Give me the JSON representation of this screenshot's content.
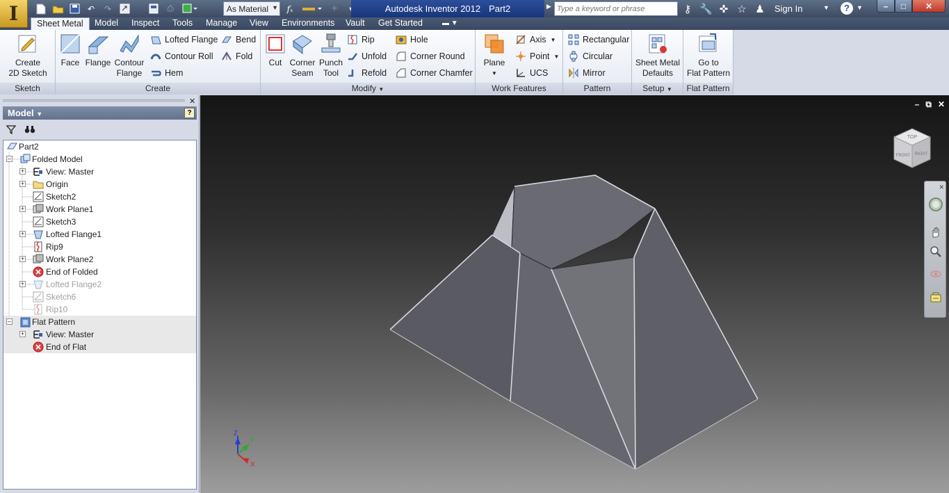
{
  "app": {
    "title": "Autodesk Inventor 2012",
    "document": "Part2",
    "material": "As Material",
    "search_placeholder": "Type a keyword or phrase",
    "sign_in": "Sign In"
  },
  "tabs": [
    "Sheet Metal",
    "Model",
    "Inspect",
    "Tools",
    "Manage",
    "View",
    "Environments",
    "Vault",
    "Get Started"
  ],
  "ribbon": {
    "sketch": {
      "title": "Sketch",
      "create_line1": "Create",
      "create_line2": "2D Sketch"
    },
    "create": {
      "title": "Create",
      "face": "Face",
      "flange": "Flange",
      "contour_line1": "Contour",
      "contour_line2": "Flange",
      "lofted": "Lofted Flange",
      "contour_roll": "Contour Roll",
      "hem": "Hem",
      "bend": "Bend",
      "fold": "Fold"
    },
    "modify": {
      "title": "Modify",
      "cut": "Cut",
      "corner_line1": "Corner",
      "corner_line2": "Seam",
      "punch_line1": "Punch",
      "punch_line2": "Tool",
      "rip": "Rip",
      "unfold": "Unfold",
      "refold": "Refold",
      "hole": "Hole",
      "corner_round": "Corner Round",
      "corner_chamfer": "Corner Chamfer"
    },
    "work": {
      "title": "Work Features",
      "plane": "Plane",
      "axis": "Axis",
      "point": "Point",
      "ucs": "UCS"
    },
    "pattern": {
      "title": "Pattern",
      "rect": "Rectangular",
      "circ": "Circular",
      "mirror": "Mirror"
    },
    "setup": {
      "title": "Setup",
      "line1": "Sheet Metal",
      "line2": "Defaults"
    },
    "flat": {
      "title": "Flat Pattern",
      "line1": "Go to",
      "line2": "Flat Pattern"
    }
  },
  "browser": {
    "title": "Model",
    "tree": [
      {
        "label": "Part2"
      },
      {
        "label": "Folded Model"
      },
      {
        "label": "View: Master"
      },
      {
        "label": "Origin"
      },
      {
        "label": "Sketch2"
      },
      {
        "label": "Work Plane1"
      },
      {
        "label": "Sketch3"
      },
      {
        "label": "Lofted Flange1"
      },
      {
        "label": "Rip9"
      },
      {
        "label": "Work Plane2"
      },
      {
        "label": "End of Folded"
      },
      {
        "label": "Lofted Flange2"
      },
      {
        "label": "Sketch6"
      },
      {
        "label": "Rip10"
      },
      {
        "label": "Flat Pattern"
      },
      {
        "label": "View: Master"
      },
      {
        "label": "End of Flat"
      }
    ]
  },
  "viewcube": {
    "top": "TOP",
    "front": "FRONT",
    "right": "RIGHT"
  },
  "triad": {
    "x": "X",
    "y": "Y",
    "z": "Z"
  }
}
